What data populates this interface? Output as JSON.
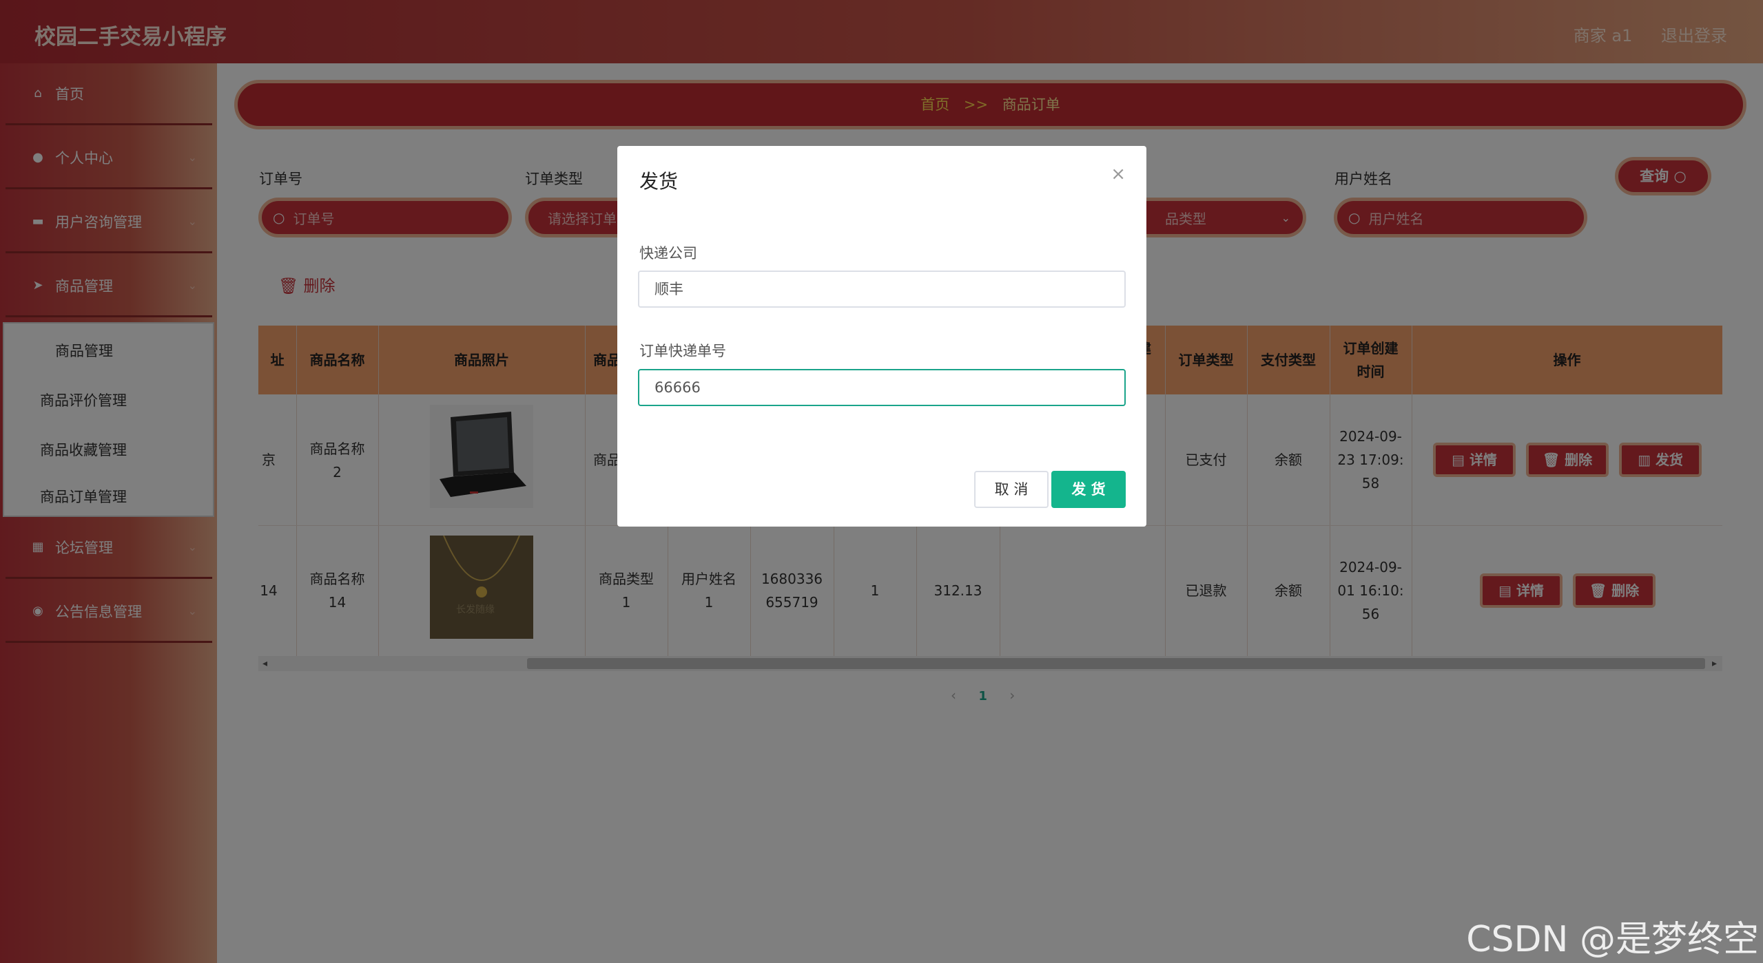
{
  "header": {
    "app_title": "校园二手交易小程序",
    "user": "商家 a1",
    "logout": "退出登录"
  },
  "sidebar": {
    "items": [
      {
        "label": "首页",
        "icon": "home-icon"
      },
      {
        "label": "个人中心",
        "icon": "person-icon"
      },
      {
        "label": "用户咨询管理",
        "icon": "chat-icon"
      },
      {
        "label": "商品管理",
        "icon": "send-icon"
      },
      {
        "label": "论坛管理",
        "icon": "grid-icon"
      },
      {
        "label": "公告信息管理",
        "icon": "pin-icon"
      }
    ],
    "submenu": [
      "商品管理",
      "商品评价管理",
      "商品收藏管理",
      "商品订单管理"
    ]
  },
  "breadcrumb": {
    "home": "首页",
    "sep": ">>",
    "current": "商品订单"
  },
  "filters": {
    "order_no_label": "订单号",
    "order_no_placeholder": "订单号",
    "order_type_label": "订单类型",
    "order_type_placeholder": "请选择订单",
    "pay_type_placeholder": "品类型",
    "username_label": "用户姓名",
    "username_placeholder": "用户姓名",
    "query_label": "查询"
  },
  "toolbar": {
    "delete_label": "删除"
  },
  "table": {
    "headers": {
      "addr": "址",
      "name": "商品名称",
      "photo": "商品照片",
      "type": "商品",
      "order_type": "订单类型",
      "pay_type": "支付类型",
      "created_1": "订单创建",
      "created_2": "时间",
      "ops": "操作",
      "partial": "建"
    },
    "rows": [
      {
        "addr": "京",
        "name_1": "商品名称",
        "name_2": "2",
        "type": "商品",
        "order_type": "已支付",
        "pay_type": "余额",
        "t1": "2024-09-",
        "t2": "23 17:09:",
        "t3": "58",
        "ops": [
          "详情",
          "删除",
          "发货"
        ]
      },
      {
        "addr": "14",
        "name_1": "商品名称",
        "name_2": "14",
        "type_1": "商品类型",
        "type_2": "1",
        "user_1": "用户姓名",
        "user_2": "1",
        "order_no_1": "1680336",
        "order_no_2": "655719",
        "qty": "1",
        "price": "312.13",
        "order_type": "已退款",
        "pay_type": "余额",
        "t1": "2024-09-",
        "t2": "01 16:10:",
        "t3": "56",
        "ops": [
          "详情",
          "删除"
        ]
      }
    ]
  },
  "pagination": {
    "prev": "‹",
    "page": "1",
    "next": "›"
  },
  "dialog": {
    "title": "发货",
    "close": "×",
    "courier_label": "快递公司",
    "courier_value": "顺丰",
    "tracking_label": "订单快递单号",
    "tracking_value": "66666",
    "cancel": "取 消",
    "confirm": "发 货"
  },
  "watermark": "CSDN @是梦终空",
  "colors": {
    "brand": "#c8333a",
    "accent": "#14b58d",
    "table_header": "#f7a26d"
  }
}
